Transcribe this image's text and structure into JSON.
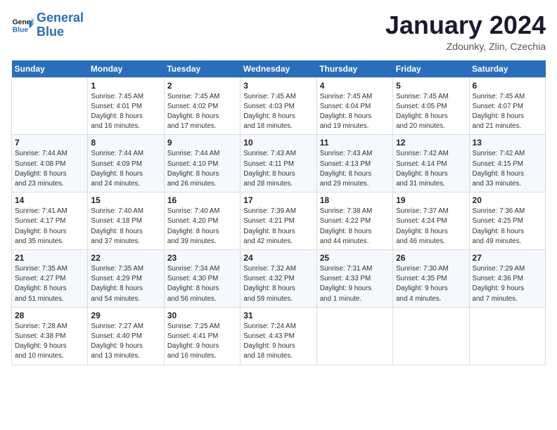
{
  "logo": {
    "line1": "General",
    "line2": "Blue"
  },
  "title": "January 2024",
  "location": "Zdounky, Zlin, Czechia",
  "days_header": [
    "Sunday",
    "Monday",
    "Tuesday",
    "Wednesday",
    "Thursday",
    "Friday",
    "Saturday"
  ],
  "weeks": [
    [
      {
        "day": "",
        "info": ""
      },
      {
        "day": "1",
        "info": "Sunrise: 7:45 AM\nSunset: 4:01 PM\nDaylight: 8 hours\nand 16 minutes."
      },
      {
        "day": "2",
        "info": "Sunrise: 7:45 AM\nSunset: 4:02 PM\nDaylight: 8 hours\nand 17 minutes."
      },
      {
        "day": "3",
        "info": "Sunrise: 7:45 AM\nSunset: 4:03 PM\nDaylight: 8 hours\nand 18 minutes."
      },
      {
        "day": "4",
        "info": "Sunrise: 7:45 AM\nSunset: 4:04 PM\nDaylight: 8 hours\nand 19 minutes."
      },
      {
        "day": "5",
        "info": "Sunrise: 7:45 AM\nSunset: 4:05 PM\nDaylight: 8 hours\nand 20 minutes."
      },
      {
        "day": "6",
        "info": "Sunrise: 7:45 AM\nSunset: 4:07 PM\nDaylight: 8 hours\nand 21 minutes."
      }
    ],
    [
      {
        "day": "7",
        "info": "Sunrise: 7:44 AM\nSunset: 4:08 PM\nDaylight: 8 hours\nand 23 minutes."
      },
      {
        "day": "8",
        "info": "Sunrise: 7:44 AM\nSunset: 4:09 PM\nDaylight: 8 hours\nand 24 minutes."
      },
      {
        "day": "9",
        "info": "Sunrise: 7:44 AM\nSunset: 4:10 PM\nDaylight: 8 hours\nand 26 minutes."
      },
      {
        "day": "10",
        "info": "Sunrise: 7:43 AM\nSunset: 4:11 PM\nDaylight: 8 hours\nand 28 minutes."
      },
      {
        "day": "11",
        "info": "Sunrise: 7:43 AM\nSunset: 4:13 PM\nDaylight: 8 hours\nand 29 minutes."
      },
      {
        "day": "12",
        "info": "Sunrise: 7:42 AM\nSunset: 4:14 PM\nDaylight: 8 hours\nand 31 minutes."
      },
      {
        "day": "13",
        "info": "Sunrise: 7:42 AM\nSunset: 4:15 PM\nDaylight: 8 hours\nand 33 minutes."
      }
    ],
    [
      {
        "day": "14",
        "info": "Sunrise: 7:41 AM\nSunset: 4:17 PM\nDaylight: 8 hours\nand 35 minutes."
      },
      {
        "day": "15",
        "info": "Sunrise: 7:40 AM\nSunset: 4:18 PM\nDaylight: 8 hours\nand 37 minutes."
      },
      {
        "day": "16",
        "info": "Sunrise: 7:40 AM\nSunset: 4:20 PM\nDaylight: 8 hours\nand 39 minutes."
      },
      {
        "day": "17",
        "info": "Sunrise: 7:39 AM\nSunset: 4:21 PM\nDaylight: 8 hours\nand 42 minutes."
      },
      {
        "day": "18",
        "info": "Sunrise: 7:38 AM\nSunset: 4:22 PM\nDaylight: 8 hours\nand 44 minutes."
      },
      {
        "day": "19",
        "info": "Sunrise: 7:37 AM\nSunset: 4:24 PM\nDaylight: 8 hours\nand 46 minutes."
      },
      {
        "day": "20",
        "info": "Sunrise: 7:36 AM\nSunset: 4:25 PM\nDaylight: 8 hours\nand 49 minutes."
      }
    ],
    [
      {
        "day": "21",
        "info": "Sunrise: 7:35 AM\nSunset: 4:27 PM\nDaylight: 8 hours\nand 51 minutes."
      },
      {
        "day": "22",
        "info": "Sunrise: 7:35 AM\nSunset: 4:29 PM\nDaylight: 8 hours\nand 54 minutes."
      },
      {
        "day": "23",
        "info": "Sunrise: 7:34 AM\nSunset: 4:30 PM\nDaylight: 8 hours\nand 56 minutes."
      },
      {
        "day": "24",
        "info": "Sunrise: 7:32 AM\nSunset: 4:32 PM\nDaylight: 8 hours\nand 59 minutes."
      },
      {
        "day": "25",
        "info": "Sunrise: 7:31 AM\nSunset: 4:33 PM\nDaylight: 9 hours\nand 1 minute."
      },
      {
        "day": "26",
        "info": "Sunrise: 7:30 AM\nSunset: 4:35 PM\nDaylight: 9 hours\nand 4 minutes."
      },
      {
        "day": "27",
        "info": "Sunrise: 7:29 AM\nSunset: 4:36 PM\nDaylight: 9 hours\nand 7 minutes."
      }
    ],
    [
      {
        "day": "28",
        "info": "Sunrise: 7:28 AM\nSunset: 4:38 PM\nDaylight: 9 hours\nand 10 minutes."
      },
      {
        "day": "29",
        "info": "Sunrise: 7:27 AM\nSunset: 4:40 PM\nDaylight: 9 hours\nand 13 minutes."
      },
      {
        "day": "30",
        "info": "Sunrise: 7:25 AM\nSunset: 4:41 PM\nDaylight: 9 hours\nand 16 minutes."
      },
      {
        "day": "31",
        "info": "Sunrise: 7:24 AM\nSunset: 4:43 PM\nDaylight: 9 hours\nand 18 minutes."
      },
      {
        "day": "",
        "info": ""
      },
      {
        "day": "",
        "info": ""
      },
      {
        "day": "",
        "info": ""
      }
    ]
  ]
}
